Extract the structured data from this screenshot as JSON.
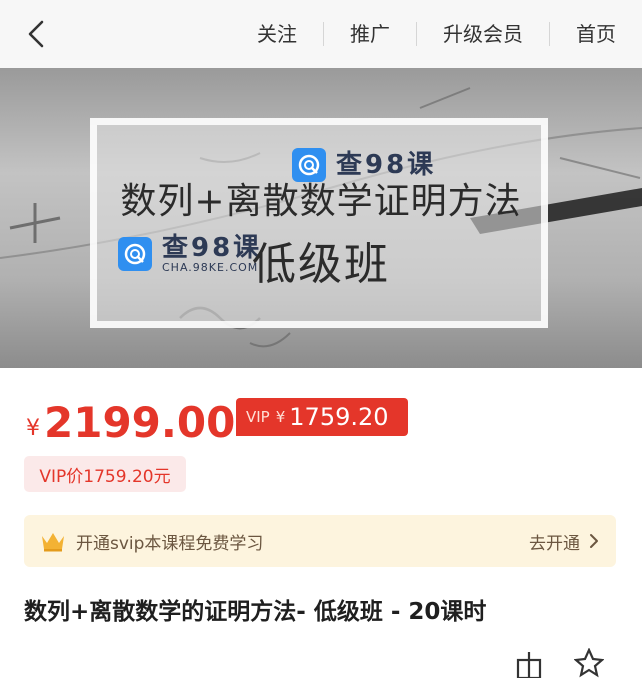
{
  "header": {
    "back_icon": "chevron-left-icon",
    "nav": [
      {
        "label": "关注"
      },
      {
        "label": "推广"
      },
      {
        "label": "升级会员"
      },
      {
        "label": "首页"
      }
    ]
  },
  "banner": {
    "title": "数列+离散数学证明方法",
    "subtitle": "低级班",
    "watermark_text": "查98课",
    "watermark_url": "CHA.98KE.COM"
  },
  "pricing": {
    "currency": "¥",
    "price": "2199.00",
    "vip_label": "VIP",
    "vip_currency": "¥",
    "vip_price": "1759.20",
    "vip_pill": "VIP价1759.20元"
  },
  "svip": {
    "icon": "crown-icon",
    "text": "开通svip本课程免费学习",
    "cta": "去开通",
    "chevron_icon": "chevron-right-icon"
  },
  "course": {
    "title": "数列+离散数学的证明方法- 低级班 - 20课时"
  },
  "colors": {
    "accent_red": "#e4362a",
    "pill_bg": "#fbe9e9",
    "svip_bg": "#fdf4de",
    "watermark_blue": "#2f8ff0"
  }
}
